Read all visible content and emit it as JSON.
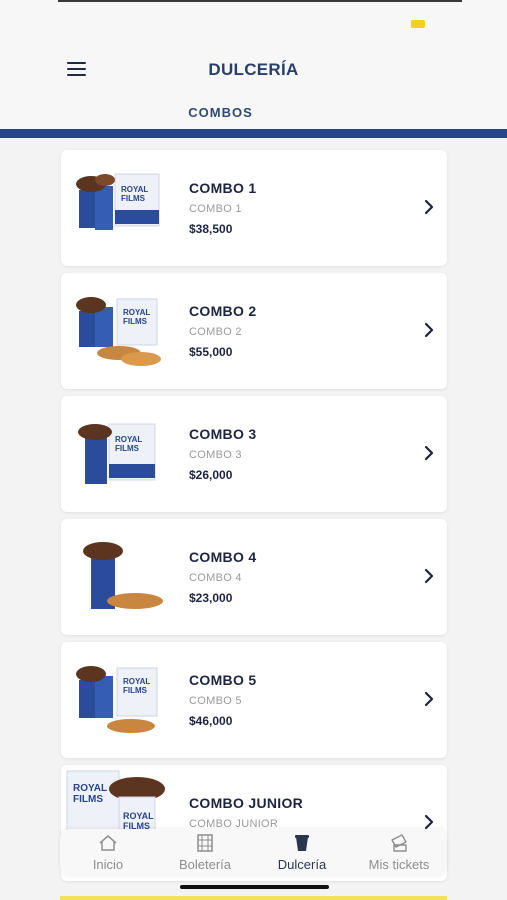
{
  "header": {
    "title": "DULCERÍA",
    "tab": "COMBOS"
  },
  "colors": {
    "accent": "#27468a",
    "title": "#27406e",
    "price": "#1d2442",
    "battery": "#f1d21a"
  },
  "combos": [
    {
      "title": "COMBO 1",
      "subtitle": "COMBO 1",
      "price": "$38,500"
    },
    {
      "title": "COMBO 2",
      "subtitle": "COMBO 2",
      "price": "$55,000"
    },
    {
      "title": "COMBO 3",
      "subtitle": "COMBO 3",
      "price": "$26,000"
    },
    {
      "title": "COMBO 4",
      "subtitle": "COMBO 4",
      "price": "$23,000"
    },
    {
      "title": "COMBO 5",
      "subtitle": "COMBO 5",
      "price": "$46,000"
    },
    {
      "title": "COMBO JUNIOR",
      "subtitle": "COMBO JUNIOR",
      "price": ""
    }
  ],
  "bottom_nav": [
    {
      "label": "Inicio",
      "icon": "home-icon",
      "active": false
    },
    {
      "label": "Boletería",
      "icon": "film-icon",
      "active": false
    },
    {
      "label": "Dulcería",
      "icon": "cup-icon",
      "active": true
    },
    {
      "label": "Mis tickets",
      "icon": "ticket-icon",
      "active": false
    }
  ]
}
